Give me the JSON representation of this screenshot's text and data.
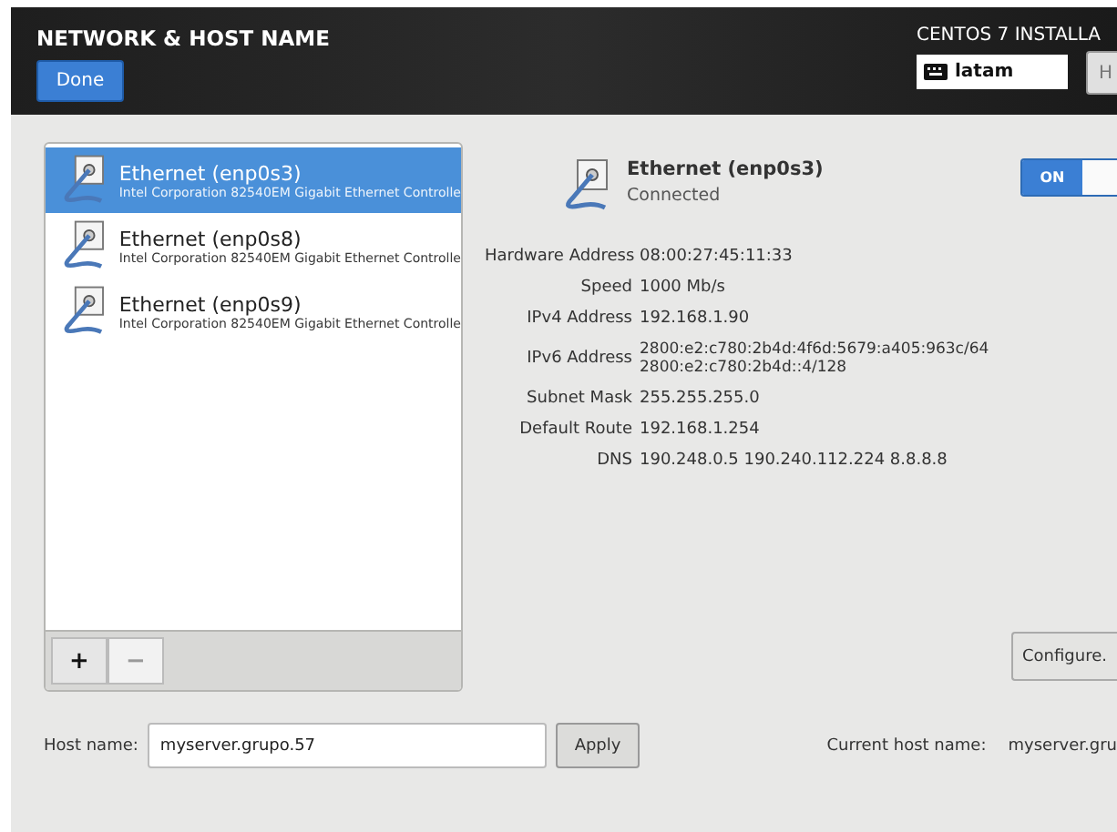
{
  "header": {
    "title": "NETWORK & HOST NAME",
    "done_button": "Done",
    "product": "CENTOS 7 INSTALLA",
    "keyboard_layout": "latam",
    "help_button": "H"
  },
  "devices": [
    {
      "name": "Ethernet (enp0s3)",
      "description": "Intel Corporation 82540EM Gigabit Ethernet Controlle",
      "selected": true
    },
    {
      "name": "Ethernet (enp0s8)",
      "description": "Intel Corporation 82540EM Gigabit Ethernet Controlle",
      "selected": false
    },
    {
      "name": "Ethernet (enp0s9)",
      "description": "Intel Corporation 82540EM Gigabit Ethernet Controlle",
      "selected": false
    }
  ],
  "list_toolbar": {
    "add": "+",
    "remove": "−"
  },
  "detail": {
    "name": "Ethernet (enp0s3)",
    "status": "Connected",
    "toggle": {
      "label": "ON",
      "on": true
    },
    "properties": [
      {
        "label": "Hardware Address",
        "values": [
          "08:00:27:45:11:33"
        ]
      },
      {
        "label": "Speed",
        "values": [
          "1000 Mb/s"
        ]
      },
      {
        "label": "IPv4 Address",
        "values": [
          "192.168.1.90"
        ]
      },
      {
        "label": "IPv6 Address",
        "values": [
          "2800:e2:c780:2b4d:4f6d:5679:a405:963c/64",
          "2800:e2:c780:2b4d::4/128"
        ]
      },
      {
        "label": "Subnet Mask",
        "values": [
          "255.255.255.0"
        ]
      },
      {
        "label": "Default Route",
        "values": [
          "192.168.1.254"
        ]
      },
      {
        "label": "DNS",
        "values": [
          "190.248.0.5 190.240.112.224 8.8.8.8"
        ]
      }
    ],
    "configure_button": "Configure."
  },
  "host": {
    "label": "Host name:",
    "value": "myserver.grupo.57",
    "apply_button": "Apply",
    "current_label": "Current host name:",
    "current_value": "myserver.gru"
  }
}
